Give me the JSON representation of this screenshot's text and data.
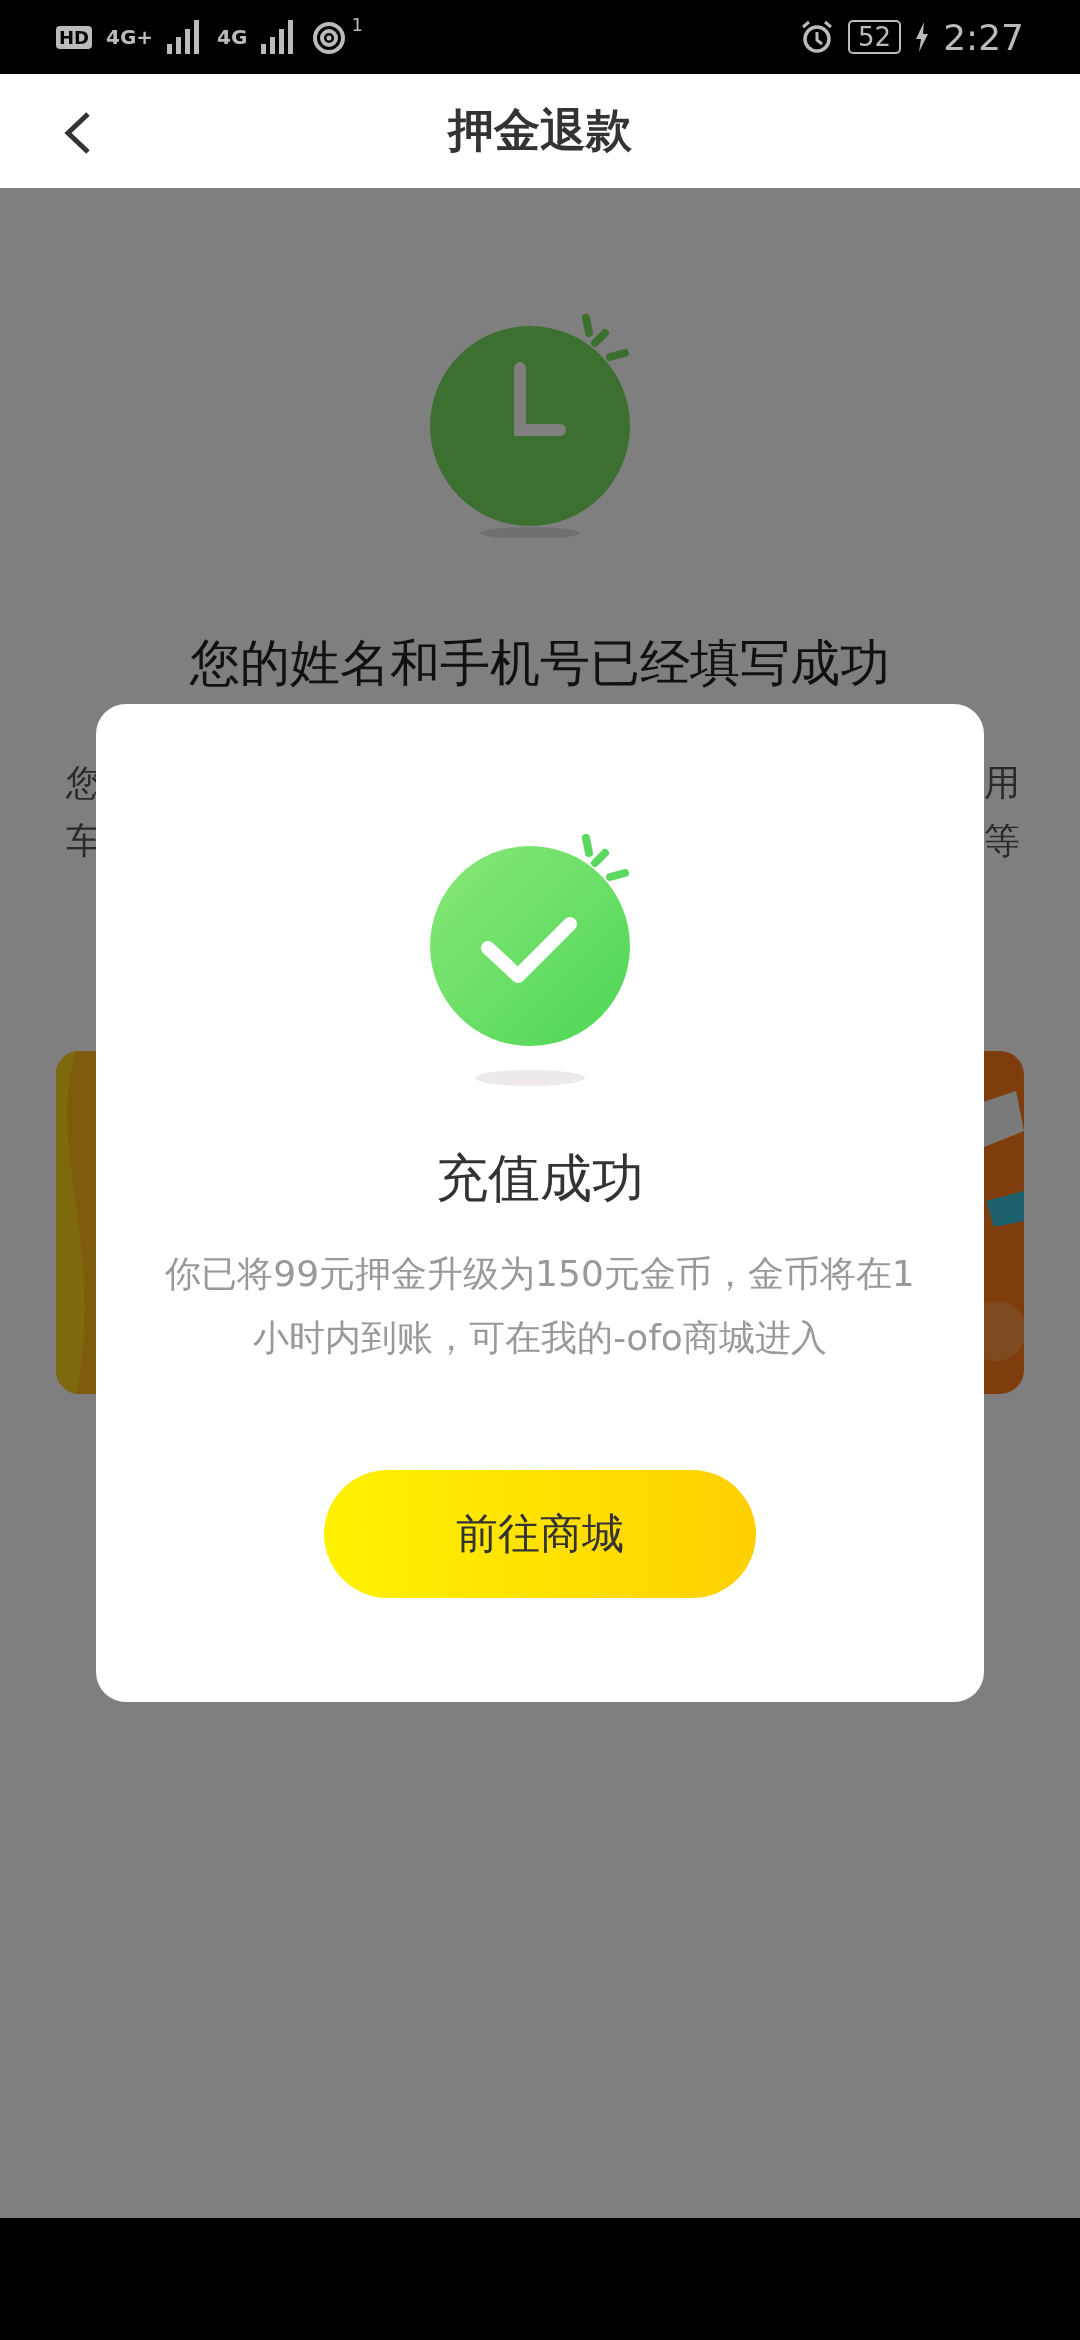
{
  "status_bar": {
    "hd": "HD",
    "network_1": "4G+",
    "network_2": "4G",
    "hotspot_count": "1",
    "battery": "52",
    "time": "2:27"
  },
  "header": {
    "title": "押金退款"
  },
  "background": {
    "heading": "您的姓名和手机号已经填写成功",
    "text_fragments": [
      {
        "left": "您",
        "right": "用"
      },
      {
        "left": "车",
        "right": "等"
      }
    ]
  },
  "dialog": {
    "title": "充值成功",
    "message": "你已将99元押金升级为150元金币，金币将在1小时内到账，可在我的-ofo商城进入",
    "button": "前往商城"
  }
}
